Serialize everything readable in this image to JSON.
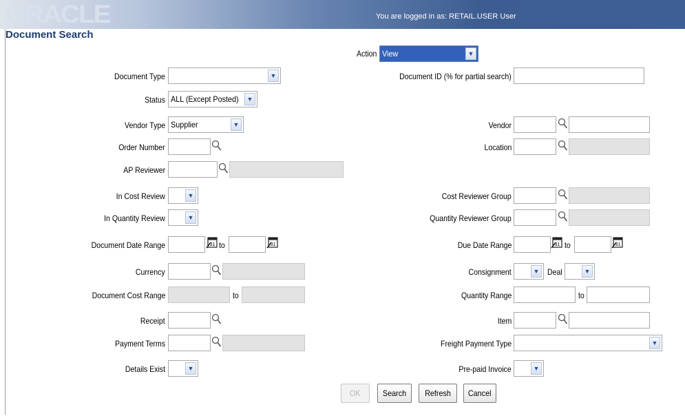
{
  "header": {
    "logo": "ORACLE",
    "logged_in": "You are logged in as: RETAIL.USER User",
    "page_title": "Document Search"
  },
  "colors": {
    "header_dark": "#3d5d92",
    "accent": "#3360b8",
    "title": "#1c3d6e"
  },
  "form": {
    "action_label": "Action",
    "action_value": "View",
    "document_type_label": "Document Type",
    "document_type_value": "",
    "document_id_label": "Document ID (% for partial search)",
    "document_id_value": "",
    "status_label": "Status",
    "status_value": "ALL (Except Posted)",
    "vendor_type_label": "Vendor Type",
    "vendor_type_value": "Supplier",
    "vendor_label": "Vendor",
    "order_number_label": "Order Number",
    "location_label": "Location",
    "ap_reviewer_label": "AP Reviewer",
    "in_cost_review_label": "In Cost Review",
    "cost_reviewer_group_label": "Cost Reviewer Group",
    "in_quantity_review_label": "In Quantity Review",
    "quantity_reviewer_group_label": "Quantity Reviewer Group",
    "document_date_range_label": "Document Date Range",
    "due_date_range_label": "Due Date Range",
    "to_label": "to",
    "currency_label": "Currency",
    "consignment_label": "Consignment",
    "deal_label": "Deal",
    "document_cost_range_label": "Document Cost Range",
    "quantity_range_label": "Quantity Range",
    "receipt_label": "Receipt",
    "item_label": "Item",
    "payment_terms_label": "Payment Terms",
    "freight_payment_type_label": "Freight Payment Type",
    "details_exist_label": "Details Exist",
    "prepaid_invoice_label": "Pre-paid Invoice",
    "calendar_glyph": "31"
  },
  "buttons": {
    "ok": "OK",
    "search": "Search",
    "refresh": "Refresh",
    "cancel": "Cancel"
  },
  "icons": {
    "lookup": "magnifier-icon",
    "calendar": "calendar-icon",
    "dropdown": "chevron-down-icon"
  }
}
